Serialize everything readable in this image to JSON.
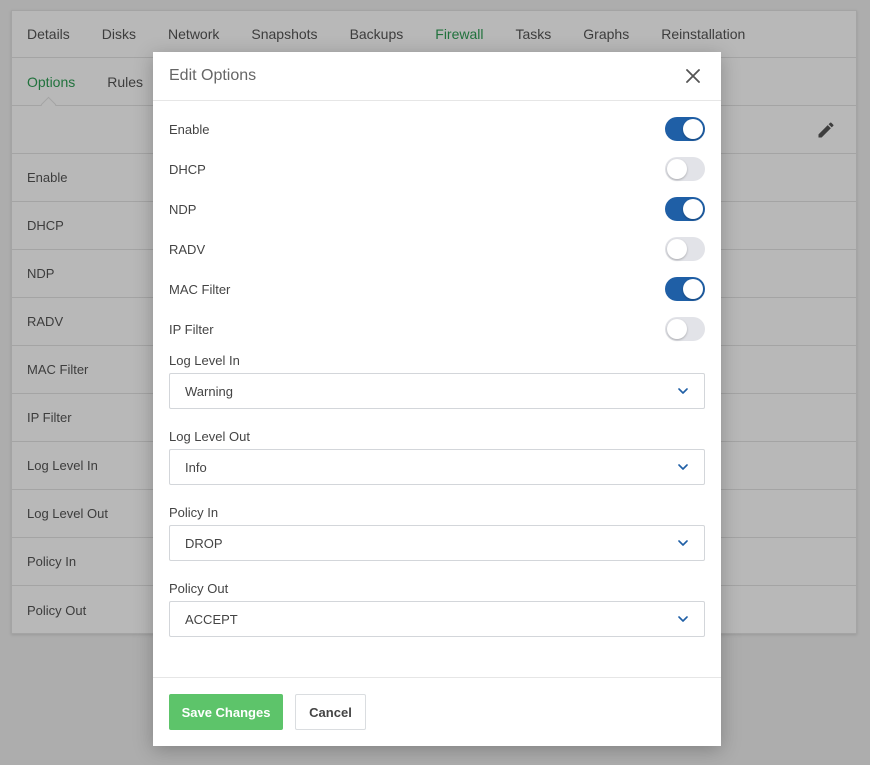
{
  "tabs": [
    {
      "label": "Details",
      "active": false
    },
    {
      "label": "Disks",
      "active": false
    },
    {
      "label": "Network",
      "active": false
    },
    {
      "label": "Snapshots",
      "active": false
    },
    {
      "label": "Backups",
      "active": false
    },
    {
      "label": "Firewall",
      "active": true
    },
    {
      "label": "Tasks",
      "active": false
    },
    {
      "label": "Graphs",
      "active": false
    },
    {
      "label": "Reinstallation",
      "active": false
    }
  ],
  "subtabs": [
    {
      "label": "Options",
      "active": true
    },
    {
      "label": "Rules",
      "active": false
    }
  ],
  "options_list": [
    "Enable",
    "DHCP",
    "NDP",
    "RADV",
    "MAC Filter",
    "IP Filter",
    "Log Level In",
    "Log Level Out",
    "Policy In",
    "Policy Out"
  ],
  "modal": {
    "title": "Edit Options",
    "toggles": [
      {
        "label": "Enable",
        "on": true
      },
      {
        "label": "DHCP",
        "on": false
      },
      {
        "label": "NDP",
        "on": true
      },
      {
        "label": "RADV",
        "on": false
      },
      {
        "label": "MAC Filter",
        "on": true
      },
      {
        "label": "IP Filter",
        "on": false
      }
    ],
    "selects": [
      {
        "label": "Log Level In",
        "value": "Warning"
      },
      {
        "label": "Log Level Out",
        "value": "Info"
      },
      {
        "label": "Policy In",
        "value": "DROP"
      },
      {
        "label": "Policy Out",
        "value": "ACCEPT"
      }
    ],
    "save_label": "Save Changes",
    "cancel_label": "Cancel"
  },
  "colors": {
    "accent_green": "#2e9e55",
    "toggle_on": "#1f5fa6",
    "toggle_off": "#e2e3e8",
    "save_button": "#5dc46a"
  },
  "icons": {
    "edit": "pencil-icon",
    "close": "close-icon",
    "select": "chevron-down-icon"
  }
}
